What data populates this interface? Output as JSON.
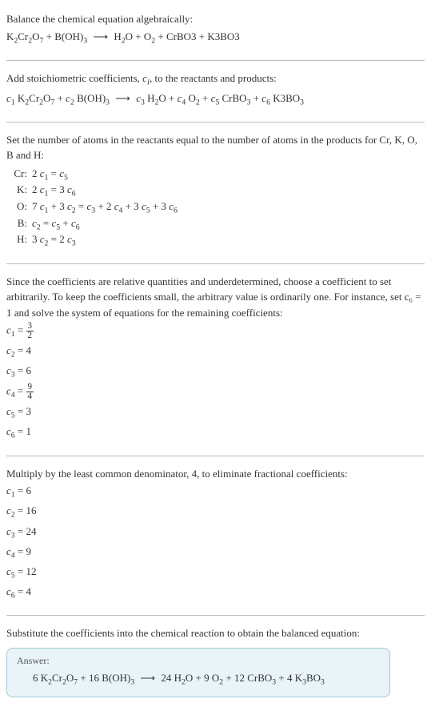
{
  "title": "Balance the chemical equation algebraically:",
  "eq1": {
    "lhs": "K₂Cr₂O₇ + B(OH)₃",
    "arrow": "⟶",
    "rhs": "H₂O + O₂ + CrBO3 + K3BO3"
  },
  "stoich_intro": "Add stoichiometric coefficients,",
  "stoich_var": "cᵢ",
  "stoich_after": ", to the reactants and products:",
  "eq2_parts": {
    "c1": "c₁",
    "t1": " K₂Cr₂O₇ + ",
    "c2": "c₂",
    "t2": " B(OH)₃ ",
    "arrow": "⟶",
    "c3": " c₃",
    "t3": " H₂O + ",
    "c4": "c₄",
    "t4": " O₂ + ",
    "c5": "c₅",
    "t5": " CrBO₃ + ",
    "c6": "c₆",
    "t6": " K3BO₃"
  },
  "atoms_intro": "Set the number of atoms in the reactants equal to the number of atoms in the products for Cr, K, O, B and H:",
  "atoms": [
    {
      "el": "Cr:",
      "eq": "2 c₁ = c₅"
    },
    {
      "el": "K:",
      "eq": "2 c₁ = 3 c₆"
    },
    {
      "el": "O:",
      "eq": "7 c₁ + 3 c₂ = c₃ + 2 c₄ + 3 c₅ + 3 c₆"
    },
    {
      "el": "B:",
      "eq": "c₂ = c₅ + c₆"
    },
    {
      "el": "H:",
      "eq": "3 c₂ = 2 c₃"
    }
  ],
  "underdet": "Since the coefficients are relative quantities and underdetermined, choose a coefficient to set arbitrarily. To keep the coefficients small, the arbitrary value is ordinarily one. For instance, set c₆ = 1 and solve the system of equations for the remaining coefficients:",
  "sol1": [
    {
      "lhs": "c₁ =",
      "frac": {
        "n": "3",
        "d": "2"
      }
    },
    {
      "lhs": "c₂ =",
      "val": "4"
    },
    {
      "lhs": "c₃ =",
      "val": "6"
    },
    {
      "lhs": "c₄ =",
      "frac": {
        "n": "9",
        "d": "4"
      }
    },
    {
      "lhs": "c₅ =",
      "val": "3"
    },
    {
      "lhs": "c₆ =",
      "val": "1"
    }
  ],
  "mult": "Multiply by the least common denominator, 4, to eliminate fractional coefficients:",
  "sol2": [
    {
      "lhs": "c₁ =",
      "val": "6"
    },
    {
      "lhs": "c₂ =",
      "val": "16"
    },
    {
      "lhs": "c₃ =",
      "val": "24"
    },
    {
      "lhs": "c₄ =",
      "val": "9"
    },
    {
      "lhs": "c₅ =",
      "val": "12"
    },
    {
      "lhs": "c₆ =",
      "val": "4"
    }
  ],
  "subst": "Substitute the coefficients into the chemical reaction to obtain the balanced equation:",
  "answer_label": "Answer:",
  "answer_eq": "6 K₂Cr₂O₇ + 16 B(OH)₃  ⟶  24 H₂O + 9 O₂ + 12 CrBO₃ + 4 K₃BO₃",
  "chart_data": {
    "type": "table",
    "title": "Balanced chemical equation coefficients",
    "unbalanced_equation": "K2Cr2O7 + B(OH)3 -> H2O + O2 + CrBO3 + K3BO3",
    "atom_balance": {
      "Cr": "2 c1 = c5",
      "K": "2 c1 = 3 c6",
      "O": "7 c1 + 3 c2 = c3 + 2 c4 + 3 c5 + 3 c6",
      "B": "c2 = c5 + c6",
      "H": "3 c2 = 2 c3"
    },
    "solution_c6_1": {
      "c1": 1.5,
      "c2": 4,
      "c3": 6,
      "c4": 2.25,
      "c5": 3,
      "c6": 1
    },
    "solution_integer": {
      "c1": 6,
      "c2": 16,
      "c3": 24,
      "c4": 9,
      "c5": 12,
      "c6": 4
    },
    "balanced_equation": "6 K2Cr2O7 + 16 B(OH)3 -> 24 H2O + 9 O2 + 12 CrBO3 + 4 K3BO3"
  }
}
